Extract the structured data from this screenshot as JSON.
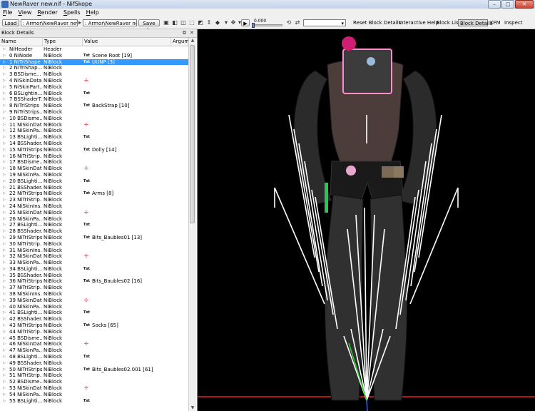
{
  "window": {
    "title": "NewRaver new.nif - NifSkope",
    "buttons": {
      "minimize": "–",
      "maximize": "□",
      "close": "✕"
    }
  },
  "menu": [
    "File",
    "View",
    "Render",
    "Spells",
    "Help"
  ],
  "toolbar": {
    "load_label": "Load",
    "load_path": ": Armor\\NewRaver new.nif",
    "save_path": ": Armor\\NewRaver new.nif",
    "save_as_label": "Save As",
    "time_value": "0.000",
    "reset_block_details": "Reset Block Details",
    "interactive_help": "Interactive Help",
    "block_list": "Block List",
    "block_details": "Block Details",
    "kfm": "KFM",
    "inspect": "Inspect"
  },
  "panel": {
    "title": "Block Details",
    "columns": [
      "Name",
      "Type",
      "Value",
      "Argum"
    ],
    "rows": [
      {
        "name": "NiHeader",
        "type": "Header",
        "txt": "",
        "value": "",
        "mark": ""
      },
      {
        "name": "0 NiNode",
        "type": "NiBlock",
        "txt": "Txt",
        "value": "Scene Root [19]",
        "mark": ""
      },
      {
        "name": "1 NiTriShape",
        "type": "NiBlock",
        "txt": "Txt",
        "value": "UUNP [3]",
        "mark": "",
        "selected": true
      },
      {
        "name": "2 NiTriShap...",
        "type": "NiBlock",
        "txt": "",
        "value": "",
        "mark": ""
      },
      {
        "name": "3 BSDisme...",
        "type": "NiBlock",
        "txt": "",
        "value": "",
        "mark": ""
      },
      {
        "name": "4 NiSkinData",
        "type": "NiBlock",
        "txt": "",
        "value": "",
        "mark": "✢"
      },
      {
        "name": "5 NiSkinPart...",
        "type": "NiBlock",
        "txt": "",
        "value": "",
        "mark": ""
      },
      {
        "name": "6 BSLightin...",
        "type": "NiBlock",
        "txt": "Txt",
        "value": "",
        "mark": ""
      },
      {
        "name": "7 BSShaderT...",
        "type": "NiBlock",
        "txt": "",
        "value": "",
        "mark": ""
      },
      {
        "name": "8 NiTriStrips",
        "type": "NiBlock",
        "txt": "Txt",
        "value": "BackStrap [10]",
        "mark": ""
      },
      {
        "name": "9 NiTriStrips...",
        "type": "NiBlock",
        "txt": "",
        "value": "",
        "mark": ""
      },
      {
        "name": "10 BSDisme...",
        "type": "NiBlock",
        "txt": "",
        "value": "",
        "mark": ""
      },
      {
        "name": "11 NiSkinData",
        "type": "NiBlock",
        "txt": "",
        "value": "",
        "mark": "✢"
      },
      {
        "name": "12 NiSkinPa...",
        "type": "NiBlock",
        "txt": "",
        "value": "",
        "mark": ""
      },
      {
        "name": "13 BSLighti...",
        "type": "NiBlock",
        "txt": "Txt",
        "value": "",
        "mark": ""
      },
      {
        "name": "14 BSShader...",
        "type": "NiBlock",
        "txt": "",
        "value": "",
        "mark": ""
      },
      {
        "name": "15 NiTriStrips",
        "type": "NiBlock",
        "txt": "Txt",
        "value": "Dolly [14]",
        "mark": ""
      },
      {
        "name": "16 NiTriStrip...",
        "type": "NiBlock",
        "txt": "",
        "value": "",
        "mark": ""
      },
      {
        "name": "17 BSDisme...",
        "type": "NiBlock",
        "txt": "",
        "value": "",
        "mark": ""
      },
      {
        "name": "18 NiSkinData",
        "type": "NiBlock",
        "txt": "",
        "value": "",
        "mark": "✢"
      },
      {
        "name": "19 NiSkinPa...",
        "type": "NiBlock",
        "txt": "",
        "value": "",
        "mark": ""
      },
      {
        "name": "20 BSLighti...",
        "type": "NiBlock",
        "txt": "Txt",
        "value": "",
        "mark": ""
      },
      {
        "name": "21 BSShader...",
        "type": "NiBlock",
        "txt": "",
        "value": "",
        "mark": ""
      },
      {
        "name": "22 NiTriStrips",
        "type": "NiBlock",
        "txt": "Txt",
        "value": "Arms [8]",
        "mark": ""
      },
      {
        "name": "23 NiTriStrip...",
        "type": "NiBlock",
        "txt": "",
        "value": "",
        "mark": ""
      },
      {
        "name": "24 NiSkinIns...",
        "type": "NiBlock",
        "txt": "",
        "value": "",
        "mark": ""
      },
      {
        "name": "25 NiSkinData",
        "type": "NiBlock",
        "txt": "",
        "value": "",
        "mark": "✢"
      },
      {
        "name": "26 NiSkinPa...",
        "type": "NiBlock",
        "txt": "",
        "value": "",
        "mark": ""
      },
      {
        "name": "27 BSLighti...",
        "type": "NiBlock",
        "txt": "Txt",
        "value": "",
        "mark": ""
      },
      {
        "name": "28 BSShader...",
        "type": "NiBlock",
        "txt": "",
        "value": "",
        "mark": ""
      },
      {
        "name": "29 NiTriStrips",
        "type": "NiBlock",
        "txt": "Txt",
        "value": "Bits_Baubles01 [13]",
        "mark": ""
      },
      {
        "name": "30 NiTriStrip...",
        "type": "NiBlock",
        "txt": "",
        "value": "",
        "mark": ""
      },
      {
        "name": "31 NiSkinIns...",
        "type": "NiBlock",
        "txt": "",
        "value": "",
        "mark": ""
      },
      {
        "name": "32 NiSkinData",
        "type": "NiBlock",
        "txt": "",
        "value": "",
        "mark": "✢"
      },
      {
        "name": "33 NiSkinPa...",
        "type": "NiBlock",
        "txt": "",
        "value": "",
        "mark": ""
      },
      {
        "name": "34 BSLighti...",
        "type": "NiBlock",
        "txt": "Txt",
        "value": "",
        "mark": ""
      },
      {
        "name": "35 BSShader...",
        "type": "NiBlock",
        "txt": "",
        "value": "",
        "mark": ""
      },
      {
        "name": "36 NiTriStrips",
        "type": "NiBlock",
        "txt": "Txt",
        "value": "Bits_Baubles02 [16]",
        "mark": ""
      },
      {
        "name": "37 NiTriStrip...",
        "type": "NiBlock",
        "txt": "",
        "value": "",
        "mark": ""
      },
      {
        "name": "38 NiSkinIns...",
        "type": "NiBlock",
        "txt": "",
        "value": "",
        "mark": ""
      },
      {
        "name": "39 NiSkinData",
        "type": "NiBlock",
        "txt": "",
        "value": "",
        "mark": "✢"
      },
      {
        "name": "40 NiSkinPa...",
        "type": "NiBlock",
        "txt": "",
        "value": "",
        "mark": ""
      },
      {
        "name": "41 BSLighti...",
        "type": "NiBlock",
        "txt": "Txt",
        "value": "",
        "mark": ""
      },
      {
        "name": "42 BSShader...",
        "type": "NiBlock",
        "txt": "",
        "value": "",
        "mark": ""
      },
      {
        "name": "43 NiTriStrips",
        "type": "NiBlock",
        "txt": "Txt",
        "value": "Socks [65]",
        "mark": ""
      },
      {
        "name": "44 NiTriStrip...",
        "type": "NiBlock",
        "txt": "",
        "value": "",
        "mark": ""
      },
      {
        "name": "45 BSDisme...",
        "type": "NiBlock",
        "txt": "",
        "value": "",
        "mark": ""
      },
      {
        "name": "46 NiSkinData",
        "type": "NiBlock",
        "txt": "",
        "value": "",
        "mark": "✢"
      },
      {
        "name": "47 NiSkinPa...",
        "type": "NiBlock",
        "txt": "",
        "value": "",
        "mark": ""
      },
      {
        "name": "48 BSLighti...",
        "type": "NiBlock",
        "txt": "Txt",
        "value": "",
        "mark": ""
      },
      {
        "name": "49 BSShader...",
        "type": "NiBlock",
        "txt": "",
        "value": "",
        "mark": ""
      },
      {
        "name": "50 NiTriStrips",
        "type": "NiBlock",
        "txt": "Txt",
        "value": "Bits_Baubles02.001 [61]",
        "mark": ""
      },
      {
        "name": "51 NiTriStrip...",
        "type": "NiBlock",
        "txt": "",
        "value": "",
        "mark": ""
      },
      {
        "name": "52 BSDisme...",
        "type": "NiBlock",
        "txt": "",
        "value": "",
        "mark": ""
      },
      {
        "name": "53 NiSkinData",
        "type": "NiBlock",
        "txt": "",
        "value": "",
        "mark": "✢"
      },
      {
        "name": "54 NiSkinPa...",
        "type": "NiBlock",
        "txt": "",
        "value": "",
        "mark": ""
      },
      {
        "name": "55 BSLighti...",
        "type": "NiBlock",
        "txt": "Txt",
        "value": "",
        "mark": ""
      }
    ]
  }
}
